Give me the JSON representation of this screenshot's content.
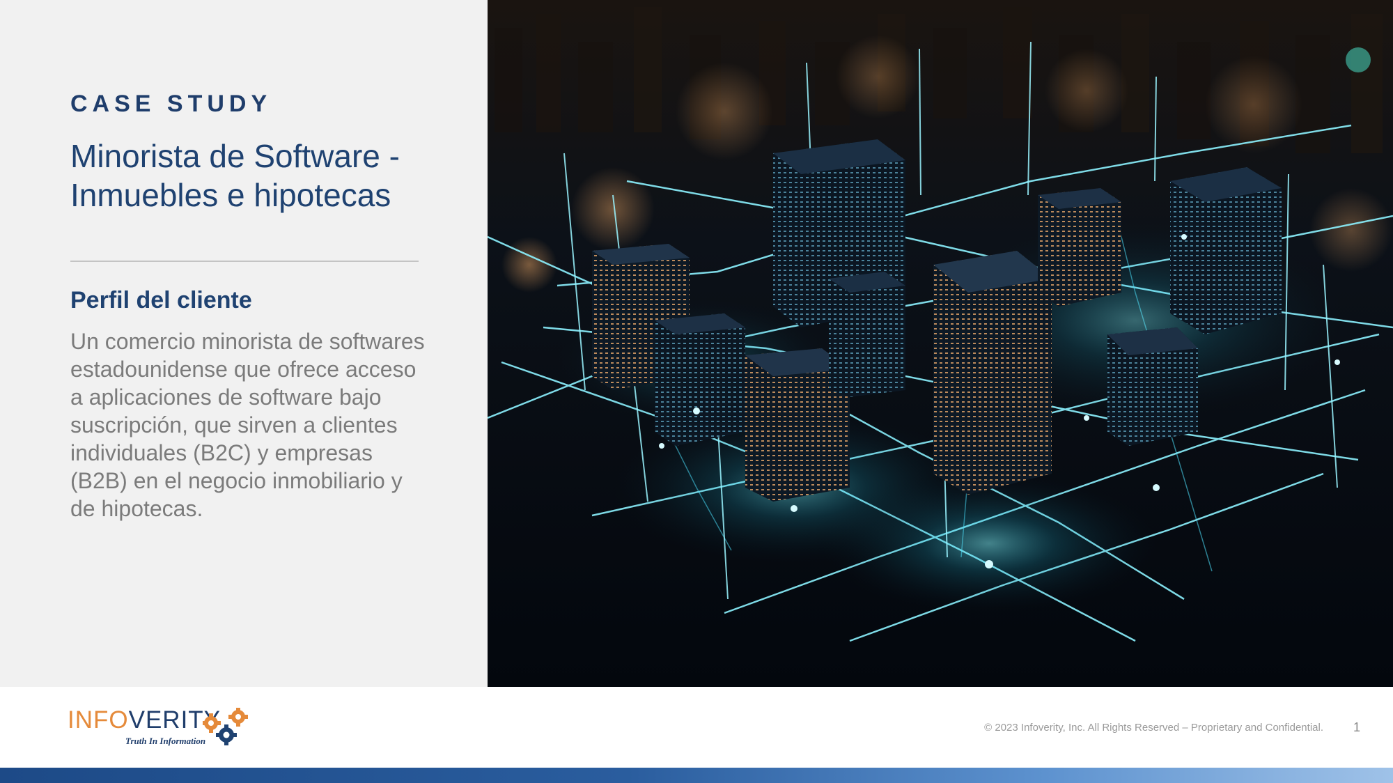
{
  "slide": {
    "eyebrow": "CASE STUDY",
    "title": "Minorista de Software - Inmuebles e hipotecas",
    "section_heading": "Perfil del cliente",
    "body": "Un comercio minorista de softwares estadounidense que ofrece acceso a aplicaciones de software bajo suscripción, que sirven a clientes individuales (B2C) y empresas (B2B) en el negocio inmobiliario y de hipotecas."
  },
  "footer": {
    "logo_part1": "INFO",
    "logo_part2": "VERITY",
    "logo_tagline": "Truth In Information",
    "copyright": "© 2023 Infoverity, Inc. All Rights Reserved – Proprietary and Confidential.",
    "page_number": "1"
  },
  "colors": {
    "brand_navy": "#1f4271",
    "brand_orange": "#e58a3a",
    "panel_gray": "#f1f1f1",
    "neon_cyan": "#5ef0ff"
  },
  "icons": {
    "hero": "futuristic-city-network-image",
    "logo_gears": "gears-icon"
  }
}
